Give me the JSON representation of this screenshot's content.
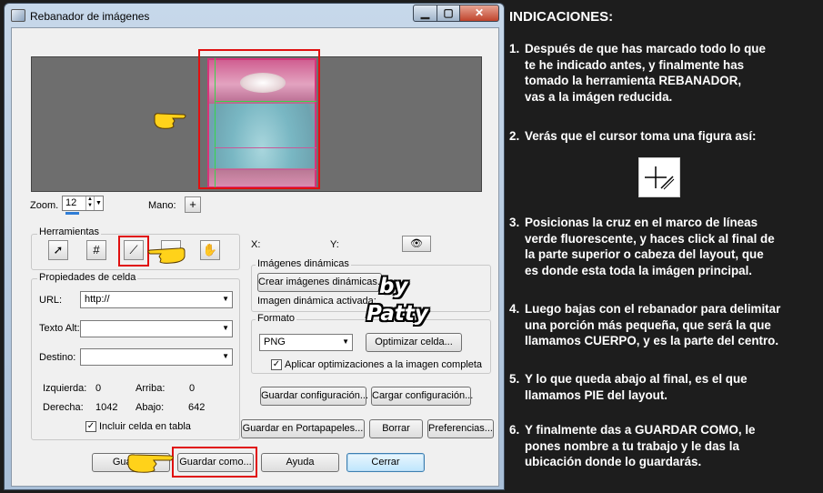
{
  "window": {
    "title": "Rebanador de imágenes"
  },
  "zoom": {
    "label": "Zoom.",
    "value": "12",
    "hand_label": "Mano:"
  },
  "tools": {
    "group_title": "Herramientas"
  },
  "coords": {
    "x_label": "X:",
    "y_label": "Y:"
  },
  "cell_props": {
    "group_title": "Propiedades de celda",
    "url_label": "URL:",
    "url_value": "http://",
    "alt_label": "Texto Alt:",
    "alt_value": "",
    "target_label": "Destino:",
    "target_value": "",
    "left_label": "Izquierda:",
    "left_value": "0",
    "top_label": "Arriba:",
    "top_value": "0",
    "right_label": "Derecha:",
    "right_value": "1042",
    "bottom_label": "Abajo:",
    "bottom_value": "642",
    "include_label": "Incluir celda en tabla"
  },
  "dynamic": {
    "group_title": "Imágenes dinámicas",
    "create_button": "Crear imágenes dinámicas...",
    "active_label": "Imagen dinámica activada:"
  },
  "format": {
    "group_title": "Formato",
    "value": "PNG",
    "optimize_button": "Optimizar celda...",
    "apply_label": "Aplicar optimizaciones a la imagen completa"
  },
  "buttons": {
    "save_config": "Guardar configuración...",
    "load_config": "Cargar configuración...",
    "save_clipboard": "Guardar en Portapapeles...",
    "delete": "Borrar",
    "preferences": "Preferencias...",
    "save": "Guardar",
    "save_as": "Guardar como...",
    "help": "Ayuda",
    "close": "Cerrar"
  },
  "watermark": {
    "line1": "by",
    "line2": "Patty"
  },
  "instructions": {
    "title": "INDICACIONES:",
    "steps": [
      {
        "num": "1.",
        "text": "Después de que has marcado todo lo que\nte he indicado antes, y finalmente has\ntomado la herramienta REBANADOR,\nvas a la imágen reducida."
      },
      {
        "num": "2.",
        "text": "Verás que el cursor toma una figura así:"
      },
      {
        "num": "3.",
        "text": "Posicionas la cruz en el marco de líneas\nverde fluorescente, y haces click al final de\nla  parte superior o cabeza del layout, que\nes donde esta toda la imágen principal."
      },
      {
        "num": "4.",
        "text": "Luego bajas con el rebanador para delimitar\nuna porción más pequeña, que será la que\nllamamos CUERPO, y es la parte del centro."
      },
      {
        "num": "5.",
        "text": "Y lo que queda abajo al final, es el que\nllamamos PIE del layout."
      },
      {
        "num": "6.",
        "text": "Y finalmente das a GUARDAR COMO, le\npones nombre a tu trabajo y le das la\nubicación donde lo guardarás."
      }
    ]
  },
  "colors": {
    "highlight": "#e01010",
    "slice_guide": "#37d64a",
    "panel_bg": "#1d1d1d"
  }
}
